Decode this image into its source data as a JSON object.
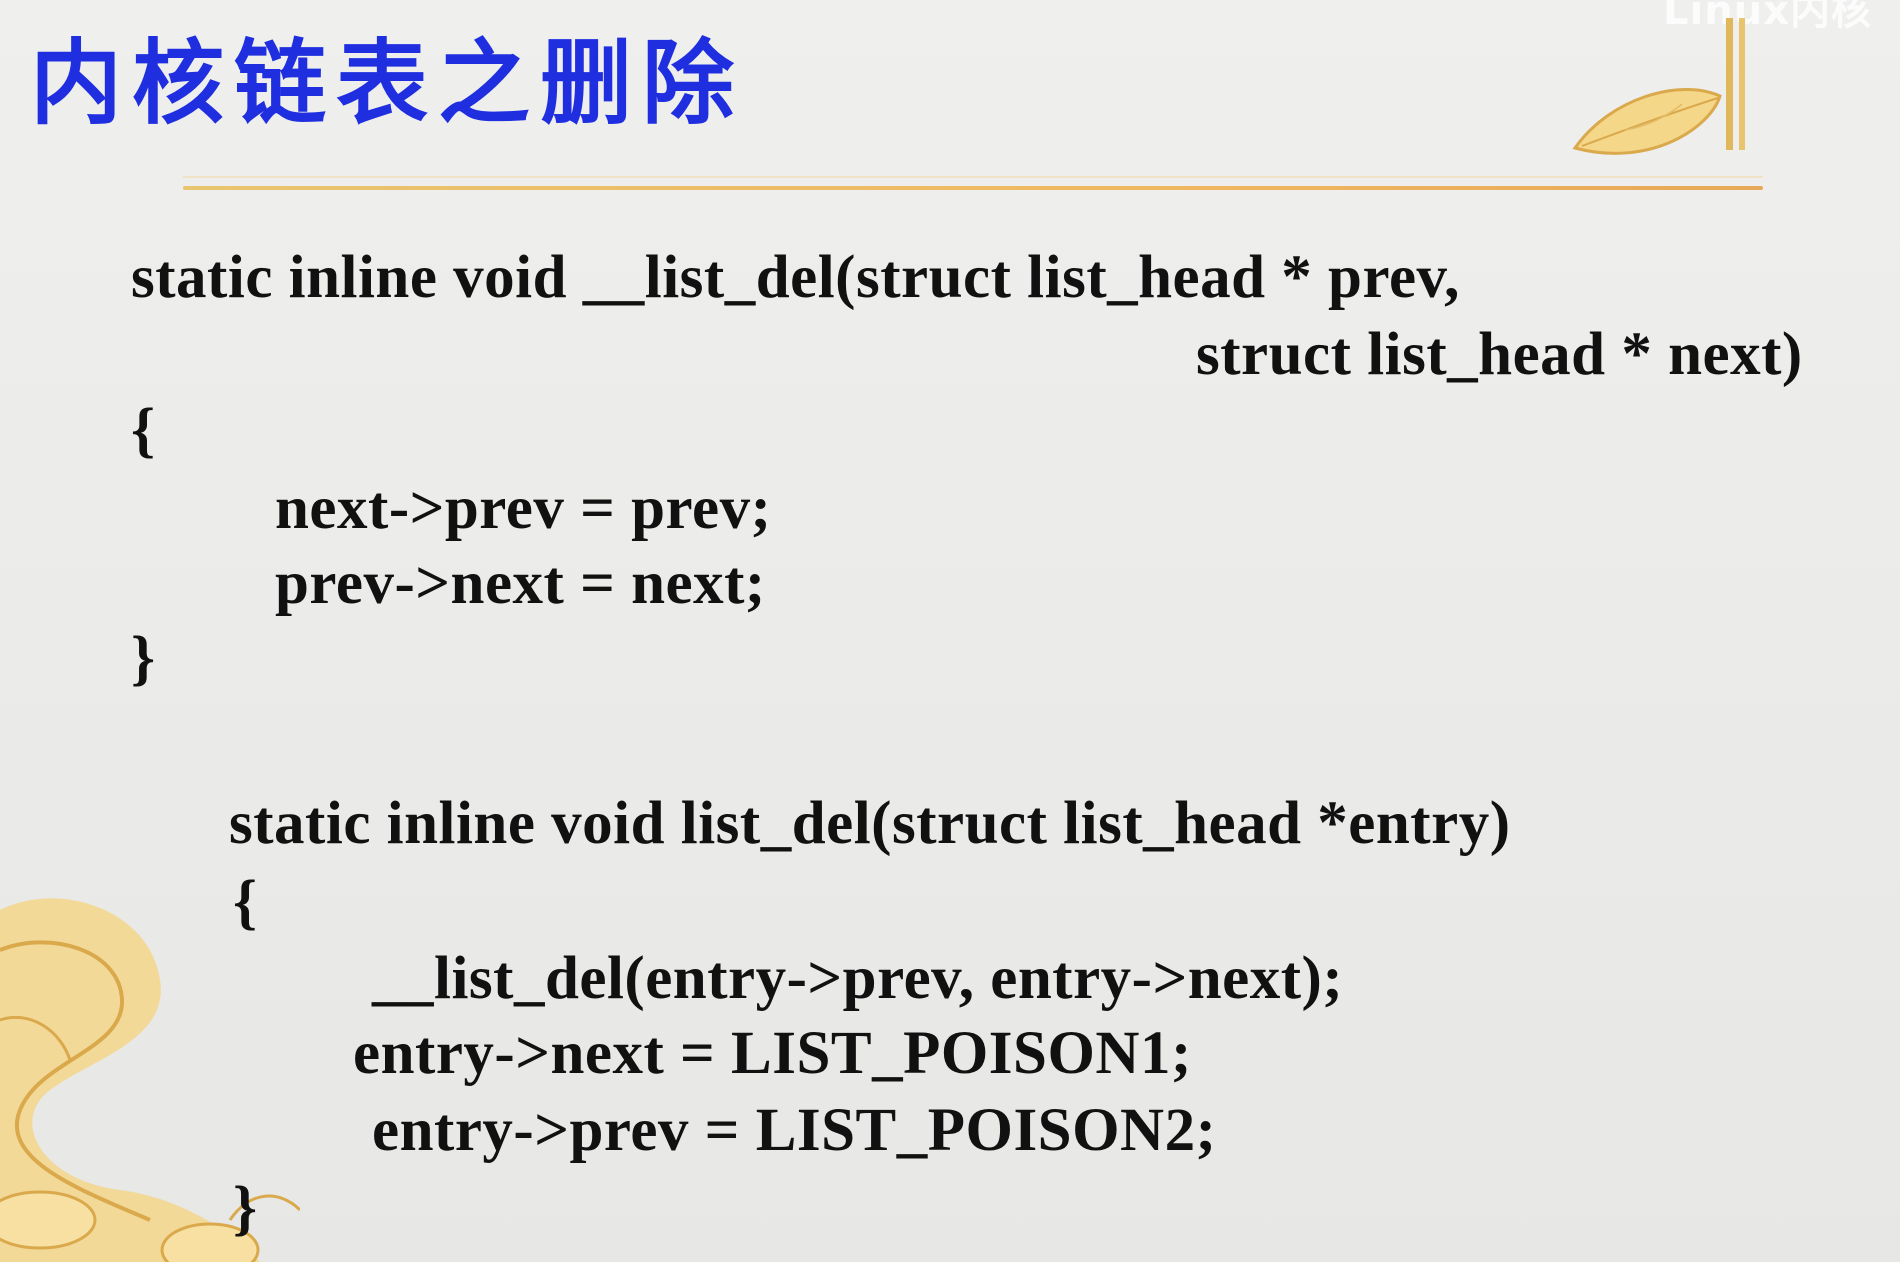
{
  "watermark": "Linux内核",
  "slide": {
    "title": "内核链表之删除"
  },
  "code": {
    "fn1": {
      "signature_line1": "static inline void __list_del(struct list_head * prev,",
      "signature_line2": "struct list_head * next)",
      "open_brace": "{",
      "body": [
        "next->prev = prev;",
        "prev->next = next;"
      ],
      "close_brace": "}"
    },
    "fn2": {
      "signature": "static inline void list_del(struct list_head *entry)",
      "open_brace": "{",
      "body": [
        "__list_del(entry->prev, entry->next);",
        "entry->next = LIST_POISON1;",
        "entry->prev = LIST_POISON2;"
      ],
      "close_brace": "}"
    }
  },
  "colors": {
    "title": "#1f2fe0",
    "rule": "#f0b860",
    "text": "#111111",
    "decoration": "#f2cf7a"
  },
  "icons": [
    "leaf-icon",
    "floral-corner-icon"
  ]
}
